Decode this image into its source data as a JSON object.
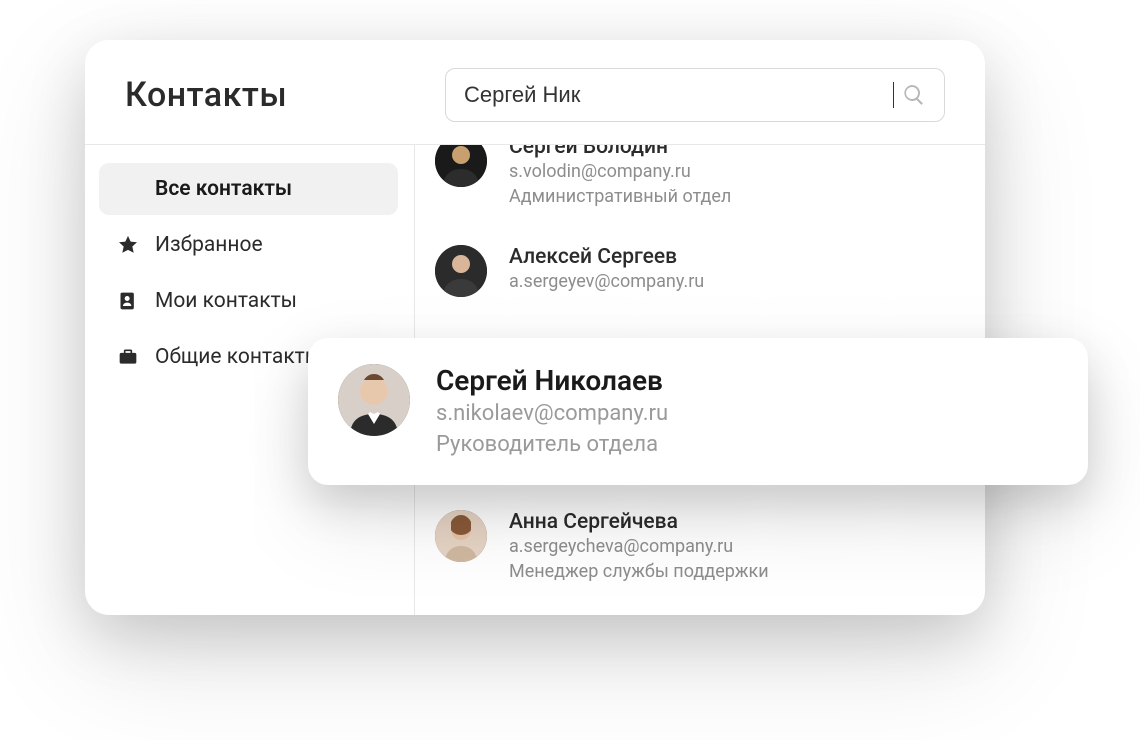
{
  "header": {
    "title": "Контакты",
    "search_value": "Сергей Ник"
  },
  "sidebar": {
    "items": [
      {
        "label": "Все контакты"
      },
      {
        "label": "Избранное"
      },
      {
        "label": "Мои контакты"
      },
      {
        "label": "Общие контакты"
      }
    ]
  },
  "contacts": [
    {
      "name": "Сергей Володин",
      "email": "s.volodin@company.ru",
      "role": "Административный отдел"
    },
    {
      "name": "Алексей Сергеев",
      "email": "a.sergeyev@company.ru",
      "role": ""
    },
    {
      "name": "Сергей Николаев",
      "email": "s.nikolaev@company.ru",
      "role": "Руководитель отдела"
    },
    {
      "name": "Анна Сергейчева",
      "email": "a.sergeycheva@company.ru",
      "role": "Менеджер службы поддержки"
    }
  ]
}
